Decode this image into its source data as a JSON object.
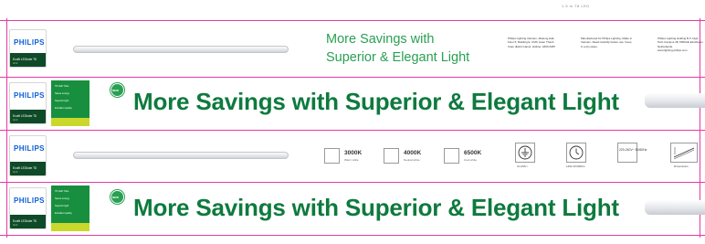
{
  "top_note": "1.5 m T8 LED",
  "brand": {
    "name": "PHILIPS",
    "product_line": "Ecofit LEDtube T8",
    "product_sub": "G13",
    "colors": {
      "blue": "#0b5ed7",
      "dark_green": "#0f4a28",
      "green": "#178f3e",
      "lime": "#c9d82b",
      "headline_green": "#0e7a3e",
      "guide_magenta": "#e23aa6"
    }
  },
  "tag_lines": [
    "T8 LED Tube",
    "Saves energy",
    "Superior light",
    "Excellent quality"
  ],
  "panel_top": {
    "headline_line1": "More Savings with",
    "headline_line2": "Superior & Elegant Light",
    "info_blocks": [
      "Philips Lighting Vietnam, Mekong Hall, Floor 5, Building E. CMC tower Thanh Xuan district Hanoi. Hotline: 1800 0087",
      "Manufactured for Philips Lighting. Made in Vietnam. Read carefully before use. Keep in a dry place.",
      "Philips Lighting Holding B.V. High Tech Campus 48, 5656AE Eindhoven Netherlands. www.lighting.philips.com"
    ]
  },
  "panel_banner": {
    "badge": "NEW",
    "headline": "More Savings with Superior & Elegant Light"
  },
  "panel_specs": {
    "color_temps": [
      {
        "value": "3000K",
        "label": "Warm white"
      },
      {
        "value": "4000K",
        "label": "Neutral white"
      },
      {
        "value": "6500K",
        "label": "Cool white"
      }
    ],
    "icons": [
      {
        "icon": "class-one-earth-icon",
        "label": "CLASS I"
      },
      {
        "icon": "life-hours-clock-icon",
        "label": "LIFE 30 000hrs"
      },
      {
        "icon": "voltage-icon",
        "text": "220-240V~ 50/60Hz"
      },
      {
        "icon": "dimensions-drawing-icon",
        "label": "Dimensions"
      }
    ]
  },
  "panel_bottom": {
    "badge": "NEW",
    "headline": "More Savings with Superior & Elegant Light"
  }
}
